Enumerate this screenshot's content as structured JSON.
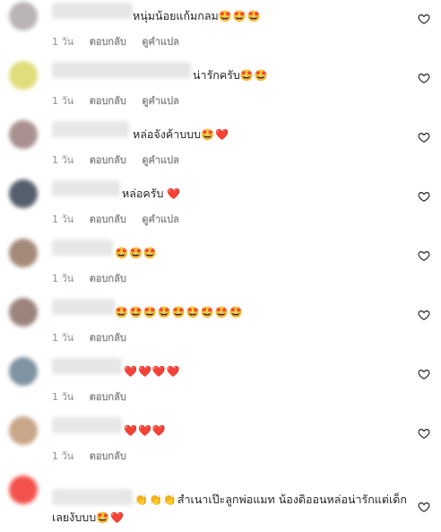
{
  "heart_icon": "heart-outline-icon",
  "colors": {
    "meta": "#8e8e8e",
    "text": "#262626"
  },
  "comments": [
    {
      "text": "หนุ่มน้อยแก้มกลม",
      "emoji": "🤩🤩🤩",
      "time": "1 วัน",
      "reply": "ตอบกลับ",
      "translate": "ดูคำแปล"
    },
    {
      "text": "น่ารักครับ",
      "emoji": "🤩🤩",
      "time": "1 วัน",
      "reply": "ตอบกลับ",
      "translate": "ดูคำแปล"
    },
    {
      "text": "หล่อจังค้าบบบ",
      "emoji": "🤩❤️",
      "time": "1 วัน",
      "reply": "ตอบกลับ",
      "translate": "ดูคำแปล"
    },
    {
      "text": "หล่อครับ",
      "emoji": "❤️",
      "time": "1 วัน",
      "reply": "ตอบกลับ",
      "translate": "ดูคำแปล"
    },
    {
      "text": "",
      "emoji": "🤩🤩🤩",
      "time": "1 วัน",
      "reply": "ตอบกลับ"
    },
    {
      "text": "",
      "emoji": "🤩🤩🤩🤩🤩🤩🤩🤩🤩",
      "time": "1 วัน",
      "reply": "ตอบกลับ"
    },
    {
      "text": "",
      "emoji": "❤️❤️❤️❤️",
      "time": "1 วัน",
      "reply": "ตอบกลับ"
    },
    {
      "text": "",
      "emoji": "❤️❤️❤️",
      "time": "1 วัน",
      "reply": "ตอบกลับ"
    },
    {
      "text": "สำเนาเป๊ะลูกพ่อแมท น้องดิออนหล่อน่ารักแต่เด็กเลยงับบบ",
      "prefix_emoji": "👏👏👏",
      "emoji": "🤩❤️"
    }
  ]
}
